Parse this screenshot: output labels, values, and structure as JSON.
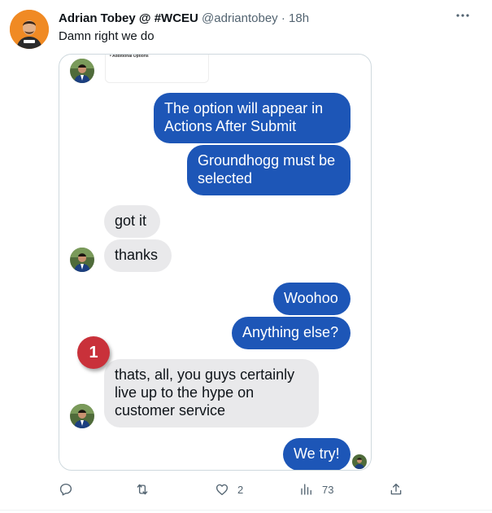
{
  "tweet": {
    "author_name": "Adrian Tobey @ #WCEU",
    "handle": "@adriantobey",
    "separator": "·",
    "time": "18h",
    "text": "Damn right we do",
    "more_icon": "more-horizontal-icon"
  },
  "image": {
    "cropped_label": "• Additional Options",
    "badge_number": "1",
    "messages": [
      {
        "from": "agent",
        "text": "The option will appear in\nActions After Submit"
      },
      {
        "from": "agent",
        "text": "Groundhogg must be\nselected"
      },
      {
        "from": "user",
        "text": "got it"
      },
      {
        "from": "user",
        "text": "thanks"
      },
      {
        "from": "agent",
        "text": "Woohoo"
      },
      {
        "from": "agent",
        "text": "Anything else?"
      },
      {
        "from": "user",
        "text": "thats, all, you guys certainly\nlive up to the hype on\ncustomer service"
      },
      {
        "from": "agent",
        "text": "We try!"
      }
    ],
    "colors": {
      "outgoing_bubble": "#1d56b7",
      "incoming_bubble": "#e9e9eb",
      "badge": "#c9313a"
    }
  },
  "actions": {
    "reply_count": "",
    "retweet_count": "",
    "like_count": "2",
    "view_count": "73",
    "icons": [
      "reply-icon",
      "retweet-icon",
      "like-icon",
      "views-icon",
      "share-icon"
    ]
  }
}
